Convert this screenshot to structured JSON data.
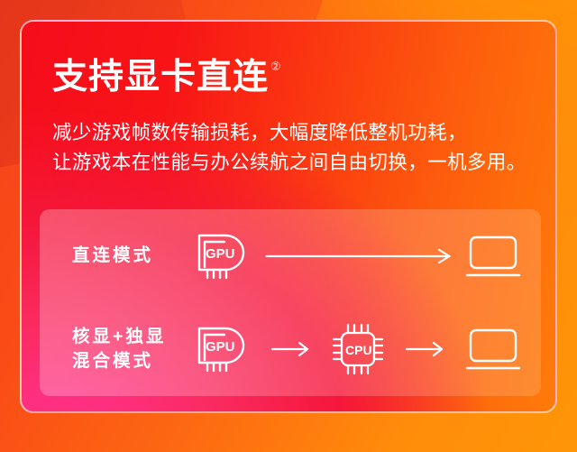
{
  "card": {
    "title": "支持显卡直连",
    "title_superscript": "②",
    "description_line_1": "减少游戏帧数传输损耗，大幅度降低整机功耗，",
    "description_line_2": "让游戏本在性能与办公续航之间自由切换，一机多用。"
  },
  "panel": {
    "rows": [
      {
        "label_line_1": "直连模式",
        "label_line_2": "",
        "flow": [
          "gpu-chip-icon",
          "long-arrow-icon",
          "laptop-icon"
        ]
      },
      {
        "label_line_1": "核显+独显",
        "label_line_2": "混合模式",
        "flow": [
          "gpu-chip-icon",
          "short-arrow-icon",
          "cpu-chip-icon",
          "short-arrow-icon",
          "laptop-icon"
        ]
      }
    ],
    "icon_labels": {
      "gpu": "GPU",
      "cpu": "CPU"
    }
  },
  "colors": {
    "background_start": "#f4441d",
    "background_end": "#ff9508",
    "card_red": "#f50d1b",
    "card_orange": "#ff7b0a",
    "card_pink": "#ff2f8a",
    "text": "#ffffff",
    "panel_overlay": "rgba(255,255,255,0.22)"
  }
}
